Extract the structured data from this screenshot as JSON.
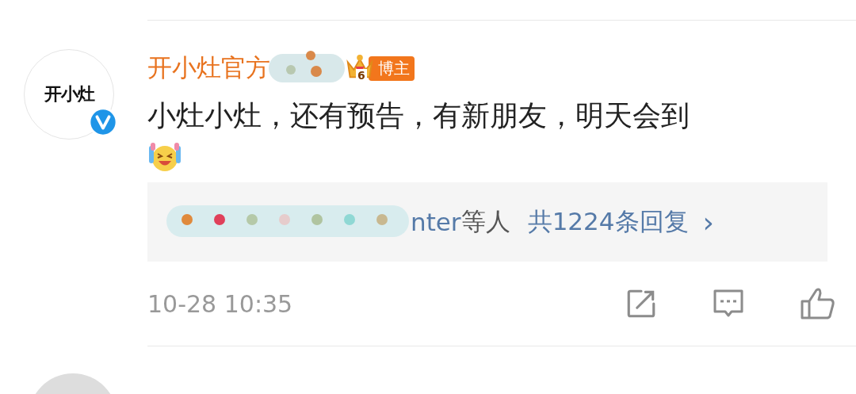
{
  "comment": {
    "avatar_text": "开小灶",
    "verified": true,
    "author": "开小灶官方",
    "author_redacted": true,
    "level": "6",
    "badge": "博主",
    "text": "小灶小灶，还有预告，有新朋友，明天会到",
    "replies": {
      "names_redacted": true,
      "names": "nter",
      "suffix": "等人",
      "count_link": "共1224条回复",
      "arrow": "›"
    },
    "time": "10-28 10:35",
    "actions": [
      {
        "kind": "share"
      },
      {
        "kind": "comment"
      },
      {
        "kind": "like"
      }
    ]
  }
}
